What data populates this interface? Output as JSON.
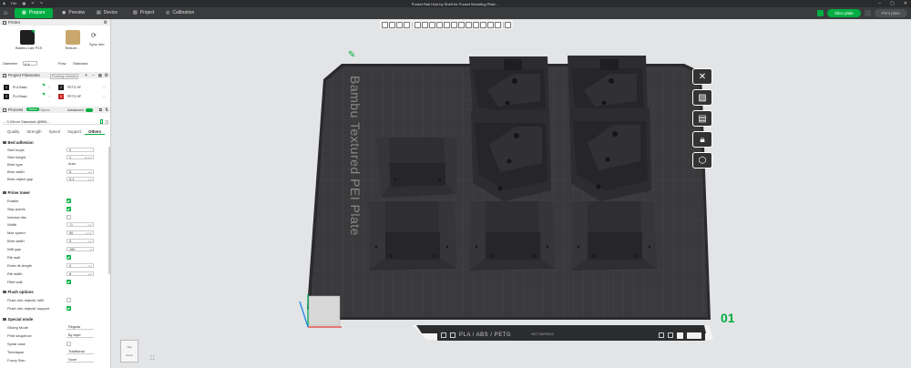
{
  "title_bar": {
    "file_label": "File",
    "document_title": "Pocket Rail Hold by Shelf for Pocket Mounting Plate ..."
  },
  "nav": {
    "tabs": [
      {
        "label": "Prepare"
      },
      {
        "label": "Preview"
      },
      {
        "label": "Device"
      },
      {
        "label": "Project"
      },
      {
        "label": "Calibration"
      }
    ],
    "slice_label": "Slice plate",
    "print_label": "Print plate"
  },
  "printer": {
    "section_label": "Printer",
    "name": "Bambu Lab P1S",
    "plate": "Texture...",
    "sync_label": "Sync info",
    "diameter_label": "Diameter",
    "diameter_value": "0.4",
    "flow_label": "Flow",
    "flow_value": "Standard"
  },
  "filaments": {
    "section_label": "Project Filaments",
    "auto_refill": "Flushing volumes",
    "items": [
      {
        "num": "1",
        "name": "PLA Basic",
        "color": "#1a1a1a"
      },
      {
        "num": "2",
        "name": "PETG HF",
        "color": "#1a1a1a"
      },
      {
        "num": "3",
        "name": "PLA Basic",
        "color": "#1a1a1a"
      },
      {
        "num": "4",
        "name": "PETG HF",
        "color": "#c62828"
      }
    ]
  },
  "process": {
    "section_label": "Process",
    "toggle_global": "Global",
    "toggle_objects": "Objects",
    "advanced_label": "Advanced",
    "profile": "0.20mm Standard @BBL...",
    "tabs": [
      "Quality",
      "Strength",
      "Speed",
      "Support",
      "Others"
    ],
    "active_tab": "Others"
  },
  "groups": {
    "bed_adhesion": "Bed adhesion",
    "prime_tower": "Prime tower",
    "flush_options": "Flush options",
    "special_mode": "Special mode"
  },
  "settings": {
    "skirt_loops": {
      "label": "Skirt loops",
      "value": "0"
    },
    "skirt_height": {
      "label": "Skirt height",
      "value": "1",
      "unit": "layers"
    },
    "brim_type": {
      "label": "Brim type",
      "value": "Auto"
    },
    "brim_width": {
      "label": "Brim width",
      "value": "5",
      "unit": "mm"
    },
    "brim_gap": {
      "label": "Brim-object gap",
      "value": "0.1",
      "unit": "mm"
    },
    "enable": {
      "label": "Enable"
    },
    "skip_points": {
      "label": "Skip points"
    },
    "internal_ribs": {
      "label": "Internal ribs"
    },
    "width": {
      "label": "Width",
      "value": "35",
      "unit": "mm"
    },
    "max_speed": {
      "label": "Max speed",
      "value": "90",
      "unit": "mm/s"
    },
    "tower_brim_width": {
      "label": "Brim width",
      "value": "3",
      "unit": "mm"
    },
    "infill_gap": {
      "label": "Infill gap",
      "value": "150",
      "unit": "%"
    },
    "rib_wall": {
      "label": "Rib wall"
    },
    "extra_rib_length": {
      "label": "Extra rib length",
      "value": "0",
      "unit": "mm"
    },
    "rib_width": {
      "label": "Rib width",
      "value": "8",
      "unit": "mm"
    },
    "fillet_wall": {
      "label": "Fillet wall"
    },
    "flush_infill": {
      "label": "Flush into objects' infill"
    },
    "flush_support": {
      "label": "Flush into objects' support"
    },
    "slicing_mode": {
      "label": "Slicing Mode",
      "value": "Regular"
    },
    "print_sequence": {
      "label": "Print sequence",
      "value": "By layer"
    },
    "spiral_vase": {
      "label": "Spiral vase"
    },
    "timelapse": {
      "label": "Timelapse",
      "value": "Traditional"
    },
    "fuzzy_skin": {
      "label": "Fuzzy Skin",
      "value": "None"
    }
  },
  "viewport": {
    "plate_text": "Bambu Textured PEI Plate",
    "plate_number": "01",
    "filament_types": "PLA / ABS / PETG",
    "surface_text": "HOT SURFACE",
    "viewcube_top": "Top",
    "viewcube_front": "Front"
  },
  "colors": {
    "accent": "#00ae42",
    "bed": "#3a3a3c",
    "part": "#2b2b2d",
    "background": "#e3e4e6"
  }
}
